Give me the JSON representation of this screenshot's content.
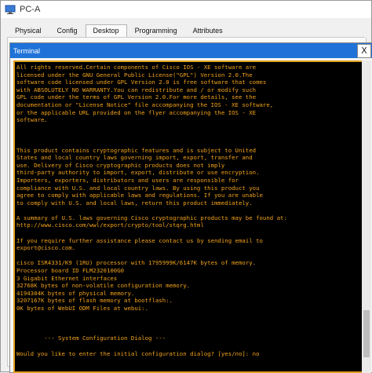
{
  "window": {
    "title": "PC-A"
  },
  "tabs": [
    {
      "label": "Physical",
      "active": false
    },
    {
      "label": "Config",
      "active": false
    },
    {
      "label": "Desktop",
      "active": true
    },
    {
      "label": "Programming",
      "active": false
    },
    {
      "label": "Attributes",
      "active": false
    }
  ],
  "terminal": {
    "title": "Terminal",
    "close_label": "X",
    "text_color": "#f2a21a",
    "lines": [
      "All rights reserved.Certain components of Cisco IOS - XE software are",
      "licensed under the GNU General Public License(\"GPL\") Version 2.0.The",
      "software code licensed under GPL Version 2.0 is free software that comes",
      "with ABSOLUTELY NO WARRANTY.You can redistribute and / or modify such",
      "GPL code under the terms of GPL Version 2.0.For more details, see the",
      "documentation or \"License Notice\" file accompanying the IOS - XE software,",
      "or the applicable URL provided on the flyer accompanying the IOS - XE",
      "software.",
      "",
      "",
      "",
      "This product contains cryptographic features and is subject to United",
      "States and local country laws governing import, export, transfer and",
      "use. Delivery of Cisco cryptographic products does not imply",
      "third-party authority to import, export, distribute or use encryption.",
      "Importers, exporters, distributors and users are responsible for",
      "compliance with U.S. and local country laws. By using this product you",
      "agree to comply with applicable laws and regulations. If you are unable",
      "to comply with U.S. and local laws, return this product immediately.",
      "",
      "A summary of U.S. laws governing Cisco cryptographic products may be found at:",
      "http://www.cisco.com/wwl/export/crypto/tool/stqrg.html",
      "",
      "If you require further assistance please contact us by sending email to",
      "export@cisco.com.",
      "",
      "cisco ISR4331/K9 (1RU) processor with 1795999K/6147K bytes of memory.",
      "Processor board ID FLM2320100G0",
      "3 Gigabit Ethernet interfaces",
      "32768K bytes of non-volatile configuration memory.",
      "4194304K bytes of physical memory.",
      "3207167K bytes of flash memory at bootflash:.",
      "0K bytes of WebUI ODM Files at webui:.",
      "",
      "",
      "",
      "        --- System Configuration Dialog ---",
      "",
      "Would you like to enter the initial configuration dialog? [yes/no]: no"
    ]
  }
}
